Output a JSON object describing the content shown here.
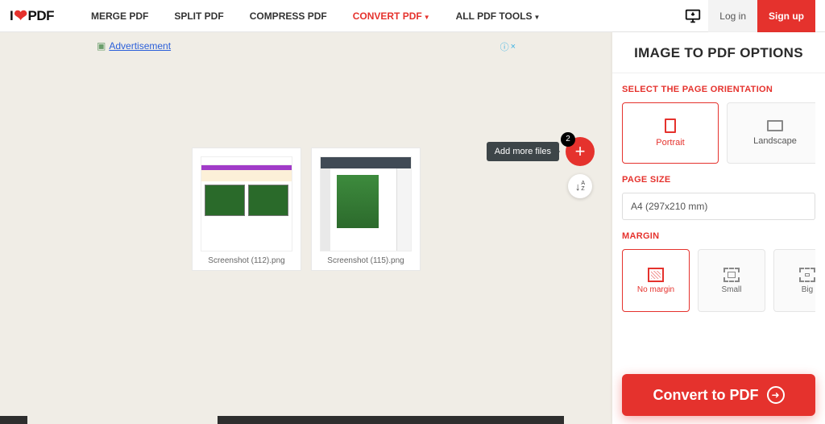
{
  "brand": {
    "prefix": "I",
    "suffix": "PDF"
  },
  "nav": {
    "merge": "MERGE PDF",
    "split": "SPLIT PDF",
    "compress": "COMPRESS PDF",
    "convert": "CONVERT PDF",
    "all": "ALL PDF TOOLS"
  },
  "auth": {
    "login": "Log in",
    "signup": "Sign up"
  },
  "ad": {
    "label": "Advertisement",
    "close": "×"
  },
  "tooltip_add": "Add more files",
  "file_badge": "2",
  "files": [
    {
      "name": "Screenshot (112).png"
    },
    {
      "name": "Screenshot (115).png"
    }
  ],
  "sidebar": {
    "title": "IMAGE TO PDF OPTIONS",
    "orientation": {
      "label": "SELECT THE PAGE ORIENTATION",
      "portrait": "Portrait",
      "landscape": "Landscape"
    },
    "page_size": {
      "label": "PAGE SIZE",
      "value": "A4 (297x210 mm)"
    },
    "margin": {
      "label": "MARGIN",
      "none": "No margin",
      "small": "Small",
      "big": "Big"
    }
  },
  "convert_btn": "Convert to PDF"
}
